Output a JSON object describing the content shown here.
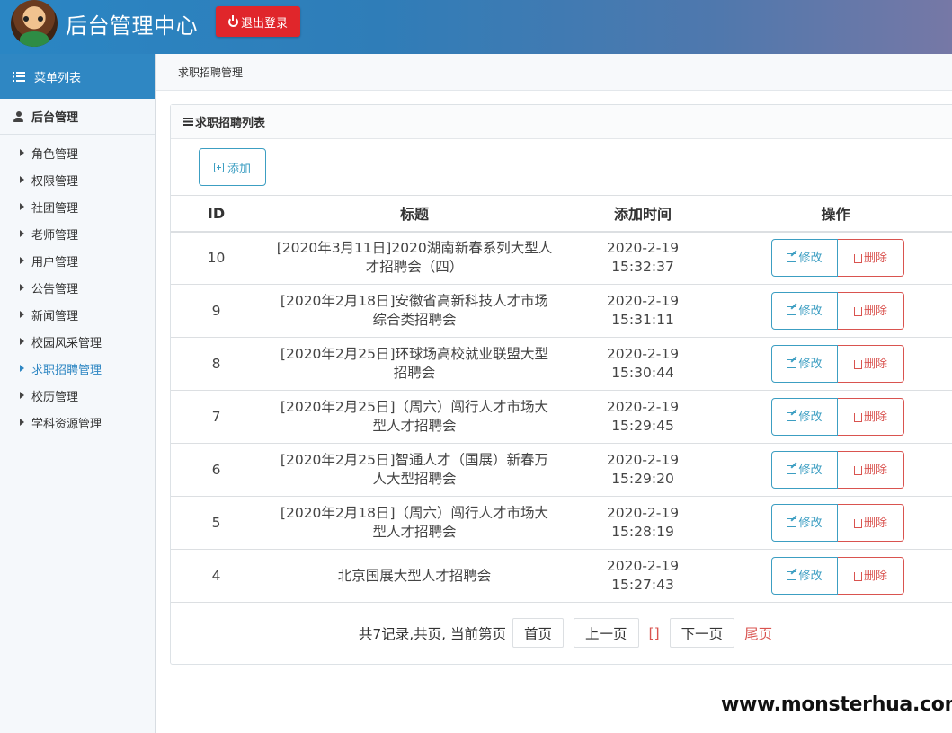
{
  "header": {
    "title": "后台管理中心",
    "logout_label": "退出登录"
  },
  "sidebar": {
    "menu_title": "菜单列表",
    "section_title": "后台管理",
    "items": [
      {
        "label": "角色管理"
      },
      {
        "label": "权限管理"
      },
      {
        "label": "社团管理"
      },
      {
        "label": "老师管理"
      },
      {
        "label": "用户管理"
      },
      {
        "label": "公告管理"
      },
      {
        "label": "新闻管理"
      },
      {
        "label": "校园风采管理"
      },
      {
        "label": "求职招聘管理",
        "active": true
      },
      {
        "label": "校历管理"
      },
      {
        "label": "学科资源管理"
      }
    ]
  },
  "breadcrumb": "求职招聘管理",
  "panel": {
    "title": "求职招聘列表",
    "add_label": "添加"
  },
  "table": {
    "headers": [
      "ID",
      "标题",
      "添加时间",
      "操作"
    ],
    "edit_label": "修改",
    "delete_label": "删除",
    "rows": [
      {
        "id": "10",
        "title": "[2020年3月11日]2020湖南新春系列大型人才招聘会（四）",
        "date": "2020-2-19",
        "time": "15:32:37"
      },
      {
        "id": "9",
        "title": "[2020年2月18日]安徽省高新科技人才市场综合类招聘会",
        "date": "2020-2-19",
        "time": "15:31:11"
      },
      {
        "id": "8",
        "title": "[2020年2月25日]环球场高校就业联盟大型招聘会",
        "date": "2020-2-19",
        "time": "15:30:44"
      },
      {
        "id": "7",
        "title": "[2020年2月25日]（周六）闯行人才市场大型人才招聘会",
        "date": "2020-2-19",
        "time": "15:29:45"
      },
      {
        "id": "6",
        "title": "[2020年2月25日]智通人才（国展）新春万人大型招聘会",
        "date": "2020-2-19",
        "time": "15:29:20"
      },
      {
        "id": "5",
        "title": "[2020年2月18日]（周六）闯行人才市场大型人才招聘会",
        "date": "2020-2-19",
        "time": "15:28:19"
      },
      {
        "id": "4",
        "title": "北京国展大型人才招聘会",
        "date": "2020-2-19",
        "time": "15:27:43"
      }
    ]
  },
  "pager": {
    "info": "共7记录,共页, 当前第页",
    "first": "首页",
    "prev": "上一页",
    "current": "[]",
    "next": "下一页",
    "last": "尾页"
  },
  "watermark": "www.monsterhua.com",
  "colors": {
    "primary": "#2f87c3",
    "danger": "#d9534f",
    "info": "#3c9ec2",
    "logout": "#e0262b"
  }
}
